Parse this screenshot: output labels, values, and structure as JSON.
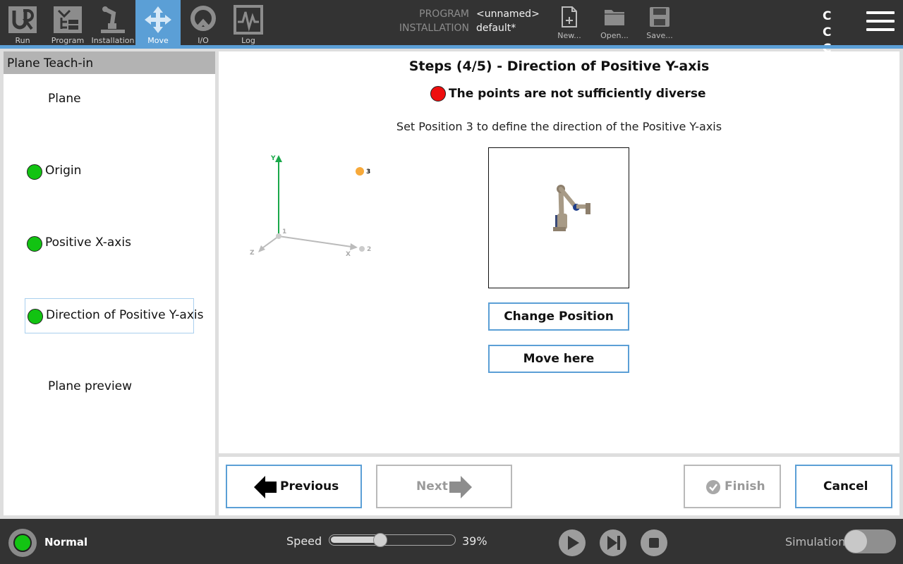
{
  "topbar": {
    "tabs": [
      {
        "label": "Run",
        "icon": "ur-logo-icon"
      },
      {
        "label": "Program",
        "icon": "program-icon"
      },
      {
        "label": "Installation",
        "icon": "installation-icon"
      },
      {
        "label": "Move",
        "icon": "move-icon",
        "active": true
      },
      {
        "label": "I/O",
        "icon": "io-icon"
      },
      {
        "label": "Log",
        "icon": "log-icon"
      }
    ],
    "program_label": "PROGRAM",
    "program_value": "<unnamed>",
    "installation_label": "INSTALLATION",
    "installation_value": "default*",
    "file_buttons": [
      {
        "label": "New...",
        "icon": "new-file-icon"
      },
      {
        "label": "Open...",
        "icon": "open-folder-icon"
      },
      {
        "label": "Save...",
        "icon": "save-disk-icon"
      }
    ],
    "cc_text": "C C C C"
  },
  "left_panel": {
    "title": "Plane Teach-in",
    "steps": [
      {
        "label": "Plane",
        "dot": false
      },
      {
        "label": "Origin",
        "dot": true,
        "dot_color": "#12c312"
      },
      {
        "label": "Positive X-axis",
        "dot": true,
        "dot_color": "#12c312"
      },
      {
        "label": "Direction of Positive Y-axis",
        "dot": true,
        "dot_color": "#12c312",
        "selected": true
      },
      {
        "label": "Plane preview",
        "dot": false
      }
    ]
  },
  "main": {
    "step_title": "Steps (4/5) - Direction of Positive Y-axis",
    "status_text": "The points are not sufficiently diverse",
    "status_color": "#ee0e0e",
    "instruction": "Set Position 3 to define the direction of the Positive Y-axis",
    "diagram": {
      "y_label": "Y",
      "x_label": "X",
      "z_label": "Z",
      "point_labels": [
        "1",
        "2",
        "3"
      ],
      "y_axis_color": "#1aa84a",
      "point3_color": "#f7a93a"
    },
    "change_position_label": "Change Position",
    "move_here_label": "Move here"
  },
  "nav": {
    "previous_label": "Previous",
    "next_label": "Next",
    "finish_label": "Finish",
    "cancel_label": "Cancel",
    "next_enabled": false,
    "finish_enabled": false
  },
  "footer": {
    "status_label": "Normal",
    "status_color": "#13c413",
    "speed_label": "Speed",
    "speed_percent": 39,
    "speed_text": "39%",
    "play_icon": "play-icon",
    "step_icon": "step-forward-icon",
    "stop_icon": "stop-icon",
    "simulation_label": "Simulation",
    "simulation_on": false
  }
}
